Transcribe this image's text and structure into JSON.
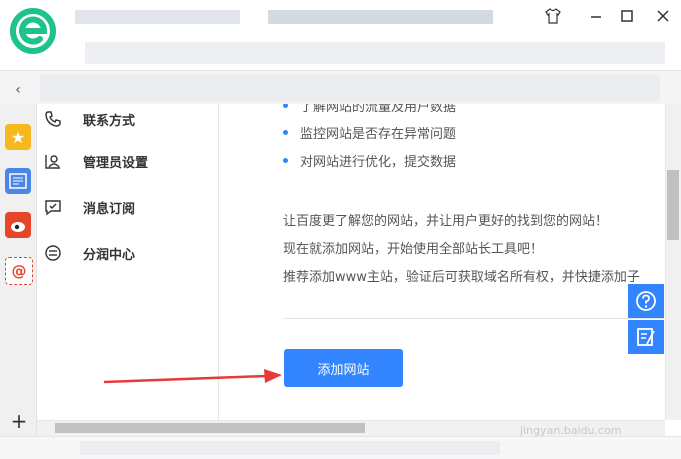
{
  "menu": {
    "items": [
      {
        "label": "联系方式",
        "icon": "phone-icon"
      },
      {
        "label": "管理员设置",
        "icon": "admin-icon"
      },
      {
        "label": "消息订阅",
        "icon": "message-icon"
      },
      {
        "label": "分润中心",
        "icon": "profit-icon"
      }
    ]
  },
  "content": {
    "bullets": [
      "了解网站的流量及用户数据",
      "监控网站是否存在异常问题",
      "对网站进行优化，提交数据"
    ],
    "paragraphs": [
      "让百度更了解您的网站，并让用户更好的找到您的网站！",
      "现在就添加网站，开始使用全部站长工具吧！",
      "推荐添加www主站，验证后可获取域名所有权，并快捷添加子"
    ],
    "add_button": "添加网站"
  },
  "dock": {
    "icons": [
      "star-icon",
      "news-icon",
      "weibo-icon",
      "mail-icon"
    ],
    "add": "+"
  },
  "titlebar": {
    "buttons": [
      "shirt-icon",
      "minimize-icon",
      "maximize-icon",
      "close-icon"
    ]
  },
  "watermark": "jingyan.baidu.com",
  "colors": {
    "accent": "#3385ff",
    "arrow": "#e83a3a",
    "logo": "#1ec28b"
  }
}
